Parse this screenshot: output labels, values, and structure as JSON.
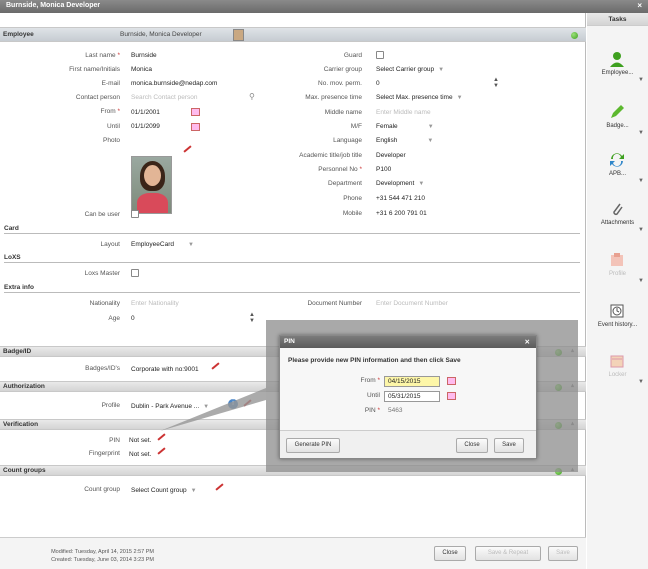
{
  "window": {
    "title": "Burnside, Monica Developer",
    "close": "×"
  },
  "employee_bar": {
    "label": "Employee",
    "name": "Burnside, Monica Developer"
  },
  "fields": {
    "last_name": {
      "label": "Last name",
      "value": "Burnside"
    },
    "first_name": {
      "label": "First name/Initials",
      "value": "Monica"
    },
    "email": {
      "label": "E-mail",
      "value": "monica.burnside@nedap.com"
    },
    "contact_person": {
      "label": "Contact person",
      "placeholder": "Search Contact person"
    },
    "from": {
      "label": "From",
      "value": "01/1/2001"
    },
    "until": {
      "label": "Until",
      "value": "01/1/2099"
    },
    "photo": {
      "label": "Photo"
    },
    "can_be_user": {
      "label": "Can be user"
    },
    "guard": {
      "label": "Guard"
    },
    "carrier_group": {
      "label": "Carrier group",
      "value": "Select Carrier group"
    },
    "no_mov_perm": {
      "label": "No. mov. perm.",
      "value": "0"
    },
    "max_presence": {
      "label": "Max. presence time",
      "value": "Select Max. presence time"
    },
    "middle_name": {
      "label": "Middle name",
      "placeholder": "Enter Middle name"
    },
    "mf": {
      "label": "M/F",
      "value": "Female"
    },
    "language": {
      "label": "Language",
      "value": "English"
    },
    "title": {
      "label": "Academic title/job title",
      "value": "Developer"
    },
    "personnel_no": {
      "label": "Personnel No",
      "value": "P100"
    },
    "department": {
      "label": "Department",
      "value": "Development"
    },
    "phone": {
      "label": "Phone",
      "value": "+31 544 471 210"
    },
    "mobile": {
      "label": "Mobile",
      "value": "+31 6 200 791 01"
    }
  },
  "card": {
    "heading": "Card",
    "layout_label": "Layout",
    "layout_value": "EmployeeCard"
  },
  "loxs": {
    "heading": "LoXS",
    "master_label": "Loxs Master"
  },
  "extra": {
    "heading": "Extra info",
    "nationality_label": "Nationality",
    "nationality_placeholder": "Enter Nationality",
    "age_label": "Age",
    "age_value": "0",
    "doc_label": "Document Number",
    "doc_placeholder": "Enter Document Number"
  },
  "badge": {
    "heading": "Badge/ID",
    "label": "Badges/ID's",
    "value": "Corporate with no:9001"
  },
  "authorization": {
    "heading": "Authorization",
    "label": "Profile",
    "value": "Dublin - Park Avenue ..."
  },
  "verification": {
    "heading": "Verification",
    "pin_label": "PIN",
    "pin_value": "Not set.",
    "fp_label": "Fingerprint",
    "fp_value": "Not set."
  },
  "count_groups": {
    "heading": "Count groups",
    "label": "Count group",
    "value": "Select Count group"
  },
  "footer": {
    "modified": "Modified: Tuesday, April 14, 2015 2:57 PM",
    "created": "Created: Tuesday, June 03, 2014 3:23 PM",
    "close": "Close",
    "save_repeat": "Save & Repeat",
    "save": "Save"
  },
  "tasks": {
    "title": "Tasks",
    "items": [
      {
        "label": "Employee...",
        "icon": "employee-icon"
      },
      {
        "label": "Badge...",
        "icon": "badge-pencil-icon"
      },
      {
        "label": "APB...",
        "icon": "apb-sync-icon"
      },
      {
        "label": "Attachments",
        "icon": "paperclip-icon"
      },
      {
        "label": "Profile",
        "icon": "profile-icon"
      },
      {
        "label": "Event history...",
        "icon": "event-history-icon"
      },
      {
        "label": "Locker",
        "icon": "locker-icon"
      }
    ]
  },
  "pin_dialog": {
    "title": "PIN",
    "instruction": "Please provide new PIN information and then click Save",
    "from_label": "From",
    "from_value": "04/15/2015",
    "until_label": "Until",
    "until_value": "05/31/2015",
    "pin_label": "PIN",
    "pin_value": "5463",
    "generate": "Generate PIN",
    "close": "Close",
    "save": "Save"
  },
  "colors": {
    "status_dot": "#3ea01f",
    "required": "#cc3333",
    "accent_pencil": "#cc3333"
  }
}
